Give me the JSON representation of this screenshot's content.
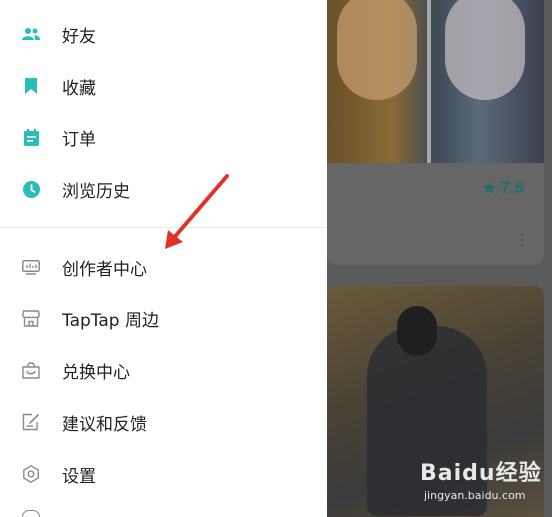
{
  "drawer": {
    "items": [
      {
        "label": "好友",
        "icon": "friends-icon"
      },
      {
        "label": "收藏",
        "icon": "bookmark-icon"
      },
      {
        "label": "订单",
        "icon": "order-icon"
      },
      {
        "label": "浏览历史",
        "icon": "clock-icon"
      },
      {
        "label": "创作者中心",
        "icon": "creator-center-icon"
      },
      {
        "label": "TapTap 周边",
        "icon": "store-icon"
      },
      {
        "label": "兑换中心",
        "icon": "shopping-bag-icon"
      },
      {
        "label": "建议和反馈",
        "icon": "feedback-edit-icon"
      },
      {
        "label": "设置",
        "icon": "settings-icon"
      }
    ]
  },
  "background": {
    "card1": {
      "rating": "7.5"
    }
  },
  "watermark": {
    "logo": "Baidu经验",
    "url": "jingyan.baidu.com"
  },
  "colors": {
    "accent_teal": "#2bbcbc",
    "outline_icon": "#8a8a8a",
    "annotation_arrow": "#e0322b"
  }
}
